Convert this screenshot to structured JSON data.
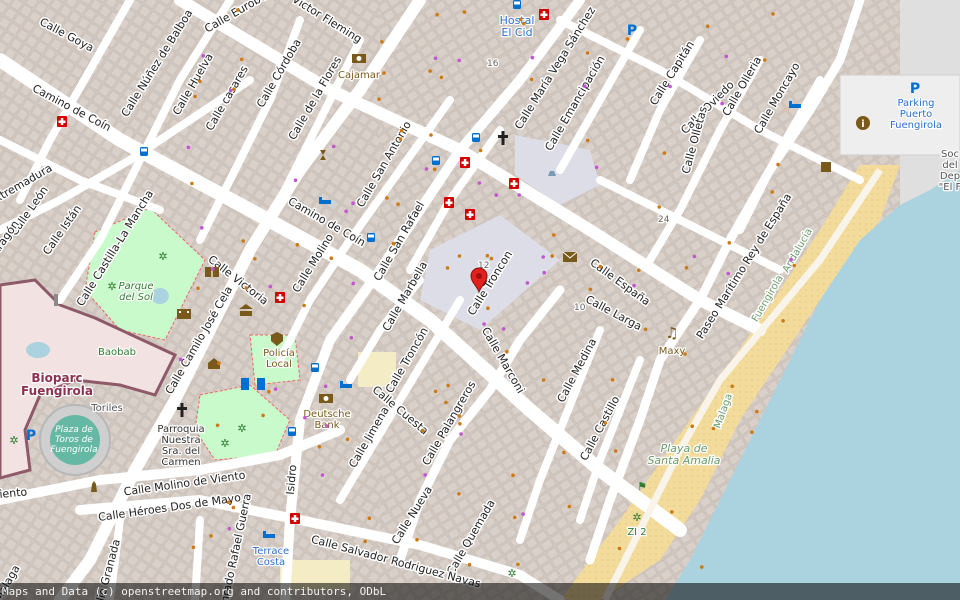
{
  "attribution": "Maps and Data (c) openstreetmap.org and contributors, ODbL",
  "colors": {
    "sea": "#aad3df",
    "beach": "#f3dc9b",
    "park": "#c8facc",
    "building": "#d9d0c9",
    "road": "#ffffff",
    "pedestrian": "#dddde8",
    "zoo": "#f2e2e2",
    "bus": "#0070d0",
    "health": "#d40000",
    "dot_shop": "#ce7a12",
    "dot_other": "#c454d4"
  },
  "streets": [
    {
      "name": "Calle Goya"
    },
    {
      "name": "Calle Núñez de Balboa"
    },
    {
      "name": "Calle Eurobell"
    },
    {
      "name": "Calle Víctor Fleming"
    },
    {
      "name": "Camino de Coín"
    },
    {
      "name": "Calle Huelva"
    },
    {
      "name": "Calle casares"
    },
    {
      "name": "Calle Córdoba"
    },
    {
      "name": "Calle de la Flores"
    },
    {
      "name": "Extremadura"
    },
    {
      "name": "Calle León"
    },
    {
      "name": "Calle Istán"
    },
    {
      "name": "Aragón"
    },
    {
      "name": "Calle Castilla-La Mancha"
    },
    {
      "name": "Calle Victoria"
    },
    {
      "name": "Calle Camilo José Cela"
    },
    {
      "name": "Calle Molino"
    },
    {
      "name": "Camino de Coín"
    },
    {
      "name": "Calle San Antonio"
    },
    {
      "name": "Calle San Rafael"
    },
    {
      "name": "Calle Marbella"
    },
    {
      "name": "Calle Troncón"
    },
    {
      "name": "Calle Troncon"
    },
    {
      "name": "Calle Cuesta"
    },
    {
      "name": "Calle Jimena"
    },
    {
      "name": "Calle Palangreros"
    },
    {
      "name": "Calle Marconi"
    },
    {
      "name": "Calle Medina"
    },
    {
      "name": "Calle Castillo"
    },
    {
      "name": "Calle Larga"
    },
    {
      "name": "Calle España"
    },
    {
      "name": "Calle María Vega Sánchez"
    },
    {
      "name": "Calle Emancipación"
    },
    {
      "name": "Calle Capitán"
    },
    {
      "name": "Calle Oviedo"
    },
    {
      "name": "Calle Olleria"
    },
    {
      "name": "Calle Olletas"
    },
    {
      "name": "Calle Moncayo"
    },
    {
      "name": "Paseo Marítimo Rey de España"
    },
    {
      "name": "Andalucía"
    },
    {
      "name": "Fuengirola"
    },
    {
      "name": "Malaga"
    },
    {
      "name": "Calle Molino de Viento"
    },
    {
      "name": "Calle Héroes Dos de Mayo"
    },
    {
      "name": "Calle Nueva"
    },
    {
      "name": "Calle Quemada"
    },
    {
      "name": "Calle Salvador Rodriguez Navas"
    },
    {
      "name": "Calle Granada"
    },
    {
      "name": "Conrado Rafael Guerra"
    },
    {
      "name": "Isidro"
    },
    {
      "name": "Viento"
    },
    {
      "name": "Malaga"
    }
  ],
  "places": [
    {
      "name": "Hostal El Cid",
      "lines": [
        "Hostal",
        "El Cid"
      ]
    },
    {
      "name": "Cajamar",
      "lines": [
        "Cajamar"
      ]
    },
    {
      "name": "Parking Puerto Fuengirola",
      "lines": [
        "Parking",
        "Puerto",
        "Fuengirola"
      ]
    },
    {
      "name": "Parque del Sol",
      "lines": [
        "Parque",
        "del Sol"
      ]
    },
    {
      "name": "Baobab",
      "lines": [
        "Baobab"
      ]
    },
    {
      "name": "Bioparc Fuengirola",
      "lines": [
        "Bioparc",
        "Fuengirola"
      ]
    },
    {
      "name": "Toriles",
      "lines": [
        "Toriles"
      ]
    },
    {
      "name": "Plaza de Toros de Fuengirola",
      "lines": [
        "Plaza de",
        "Toros de",
        "Fuengirola"
      ]
    },
    {
      "name": "Policía Local",
      "lines": [
        "Policía",
        "Local"
      ]
    },
    {
      "name": "Deutsche Bank",
      "lines": [
        "Deutsche",
        "Bank"
      ]
    },
    {
      "name": "Parroquia Nuestra Sra. del Carmen",
      "lines": [
        "Parroquia",
        "Nuestra",
        "Sra. del",
        "Carmen"
      ]
    },
    {
      "name": "Maxy",
      "lines": [
        "Maxy"
      ]
    },
    {
      "name": "Playa de Santa Amalia",
      "lines": [
        "Playa de",
        "Santa Amalia"
      ]
    },
    {
      "name": "ZI 2",
      "lines": [
        "ZI 2"
      ]
    },
    {
      "name": "Terrace Costa",
      "lines": [
        "Terrace",
        "Costa"
      ]
    },
    {
      "name": "Soc del Dep El F",
      "lines": [
        "Soc",
        "del",
        "Dep",
        "\"El F"
      ]
    }
  ],
  "house_numbers": [
    "16",
    "24",
    "12",
    "10"
  ],
  "marker": {
    "label": "location-pin"
  }
}
